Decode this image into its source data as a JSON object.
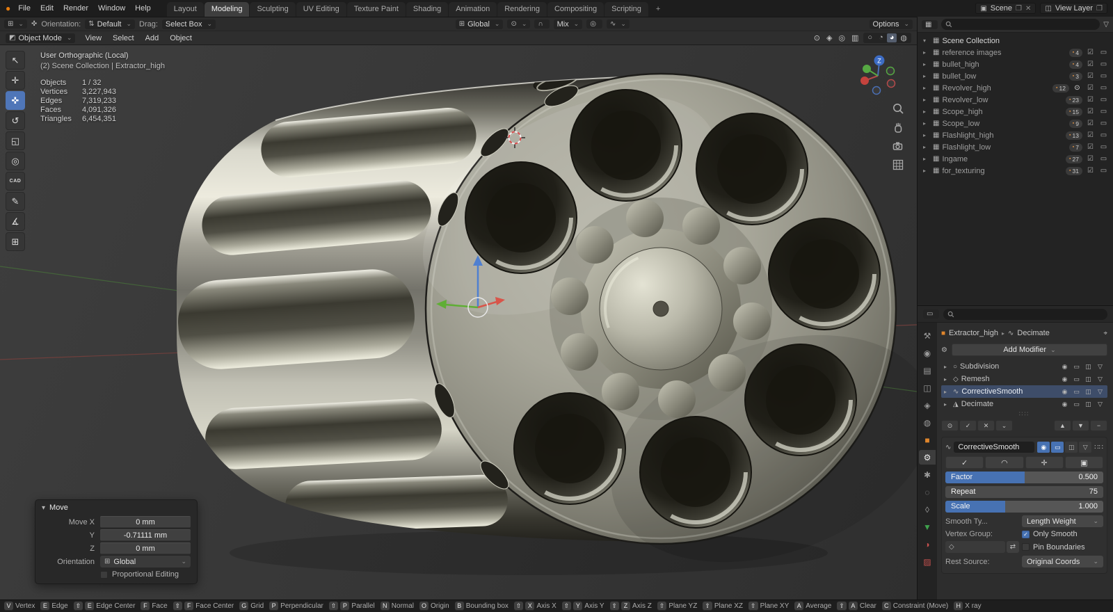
{
  "accent": "#4772b3",
  "icons": {
    "logo": "●",
    "editor_3d": "⊞",
    "move_cross": "✜",
    "orientation": "⇅",
    "scene": "▣",
    "view_layer": "◫",
    "copy": "❐",
    "close": "✕",
    "collection": "▦",
    "mesh_badge": "▪",
    "check": "☑",
    "screen": "▭",
    "eye": "⊙",
    "tri_closed": "▸",
    "tri_open": "▾",
    "filter": "▽",
    "object": "■",
    "pin": "⌖",
    "wrench": "⚙",
    "camera": "◉",
    "editmode": "◫",
    "cage": "▽",
    "dots": "∷∷",
    "spring": "∿",
    "vg": "◇",
    "swap": "⇄",
    "object_mode": "◩",
    "grid_orient": "⊞",
    "pivot": "⊙",
    "magnet": "∩",
    "prop_circle": "◎",
    "falloff": "∿",
    "xray": "▥",
    "gizmo": "◈",
    "overlays": "◎",
    "shade_wire": "○",
    "shade_solid": "◔",
    "shade_material": "◕",
    "shade_rendered": "◍"
  },
  "topbar": {
    "menus": [
      "File",
      "Edit",
      "Render",
      "Window",
      "Help"
    ],
    "workspaces": [
      "Layout",
      "Modeling",
      "Sculpting",
      "UV Editing",
      "Texture Paint",
      "Shading",
      "Animation",
      "Rendering",
      "Compositing",
      "Scripting"
    ],
    "active_workspace": "Modeling",
    "workspace_add": "+",
    "scene_label": "Scene",
    "view_layer_label": "View Layer"
  },
  "tool_settings": {
    "orientation_label": "Orientation:",
    "orientation_value": "Default",
    "drag_label": "Drag:",
    "drag_value": "Select Box",
    "transform_orientation": "Global",
    "snap_target": "Mix",
    "options_label": "Options"
  },
  "viewport_header": {
    "mode": "Object Mode",
    "menus": [
      "View",
      "Select",
      "Add",
      "Object"
    ]
  },
  "tools": [
    {
      "name": "tweak-select-tool",
      "glyph": "↖",
      "active": false
    },
    {
      "name": "cursor-tool",
      "glyph": "✛",
      "active": false
    },
    {
      "name": "move-tool",
      "glyph": "✜",
      "active": true
    },
    {
      "name": "rotate-tool",
      "glyph": "↺",
      "active": false
    },
    {
      "name": "scale-tool",
      "glyph": "◱",
      "active": false
    },
    {
      "name": "transform-tool",
      "glyph": "◎",
      "active": false
    },
    {
      "name": "cad-sketcher-tool",
      "glyph": "CAD",
      "active": false
    },
    {
      "name": "annotate-tool",
      "glyph": "✎",
      "active": false
    },
    {
      "name": "measure-tool",
      "glyph": "∡",
      "active": false
    },
    {
      "name": "add-cube-tool",
      "glyph": "⊞",
      "active": false
    }
  ],
  "viewport": {
    "view_label": "User Orthographic (Local)",
    "context_label": "(2) Scene Collection | Extractor_high",
    "stats": [
      {
        "label": "Objects",
        "value": "1 / 32"
      },
      {
        "label": "Vertices",
        "value": "3,227,943"
      },
      {
        "label": "Edges",
        "value": "7,319,233"
      },
      {
        "label": "Faces",
        "value": "4,091,326"
      },
      {
        "label": "Triangles",
        "value": "6,454,351"
      }
    ],
    "gizmo_z_label": "Z"
  },
  "move_panel": {
    "title": "Move",
    "fields": [
      {
        "label": "Move X",
        "value": "0 mm"
      },
      {
        "label": "Y",
        "value": "-0.71111 mm"
      },
      {
        "label": "Z",
        "value": "0 mm"
      }
    ],
    "orientation_label": "Orientation",
    "orientation_value": "Global",
    "proportional_label": "Proportional Editing",
    "proportional_checked": false
  },
  "outliner": {
    "root_label": "Scene Collection",
    "items": [
      {
        "name": "reference images",
        "count": "4"
      },
      {
        "name": "bullet_high",
        "count": "4"
      },
      {
        "name": "bullet_low",
        "count": "3"
      },
      {
        "name": "Revolver_high",
        "count": "12",
        "eye": true
      },
      {
        "name": "Revolver_low",
        "count": "23"
      },
      {
        "name": "Scope_high",
        "count": "15"
      },
      {
        "name": "Scope_low",
        "count": "9"
      },
      {
        "name": "Flashlight_high",
        "count": "13"
      },
      {
        "name": "Flashlight_low",
        "count": "7"
      },
      {
        "name": "Ingame",
        "count": "27"
      },
      {
        "name": "for_texturing",
        "count": "31"
      }
    ]
  },
  "properties": {
    "tabs": [
      {
        "name": "tool",
        "glyph": "⚒"
      },
      {
        "name": "render",
        "glyph": "◉"
      },
      {
        "name": "output",
        "glyph": "▤"
      },
      {
        "name": "view-layer",
        "glyph": "◫"
      },
      {
        "name": "scene",
        "glyph": "◈"
      },
      {
        "name": "world",
        "glyph": "◍"
      },
      {
        "name": "object",
        "glyph": "■",
        "color": "#e0862c"
      },
      {
        "name": "modifiers",
        "glyph": "⚙",
        "active": true
      },
      {
        "name": "particles",
        "glyph": "✱"
      },
      {
        "name": "physics",
        "glyph": "◌"
      },
      {
        "name": "constraints",
        "glyph": "◊"
      },
      {
        "name": "object-data",
        "glyph": "▼",
        "color": "#3fa34d"
      },
      {
        "name": "material",
        "glyph": "◑",
        "color": "#c4504e"
      },
      {
        "name": "texture",
        "glyph": "▨",
        "color": "#c4504e"
      }
    ],
    "breadcrumb": {
      "object": "Extractor_high",
      "modifier": "Decimate"
    },
    "add_modifier_label": "Add Modifier",
    "stack": [
      {
        "name": "Subdivision",
        "icon": "○",
        "active": false
      },
      {
        "name": "Remesh",
        "icon": "◇",
        "active": false
      },
      {
        "name": "CorrectiveSmooth",
        "icon": "∿",
        "active": true
      },
      {
        "name": "Decimate",
        "icon": "◮",
        "active": false
      }
    ],
    "stack_buttons_left": [
      {
        "name": "toggle-all-visibility",
        "glyph": "⊙"
      },
      {
        "name": "apply-all-button",
        "glyph": "✓"
      },
      {
        "name": "remove-all-button",
        "glyph": "✕"
      },
      {
        "name": "stack-extras-dropdown",
        "glyph": "⌄"
      }
    ],
    "stack_buttons_right": [
      {
        "name": "move-modifier-up",
        "glyph": "▲"
      },
      {
        "name": "move-modifier-down",
        "glyph": "▼"
      },
      {
        "name": "remove-modifier-button",
        "glyph": "−"
      }
    ],
    "detail": {
      "name": "CorrectiveSmooth",
      "toggles": [
        {
          "name": "detail-render-toggle",
          "glyph": "◉",
          "on": true
        },
        {
          "name": "detail-realtime-toggle",
          "glyph": "▭",
          "on": true
        },
        {
          "name": "detail-editmode-toggle",
          "glyph": "◫",
          "on": false
        },
        {
          "name": "detail-cage-toggle",
          "glyph": "▽",
          "on": false
        }
      ],
      "actions": [
        {
          "name": "apply-modifier-button",
          "glyph": "✓"
        },
        {
          "name": "smooth-preview-button",
          "glyph": "◠"
        },
        {
          "name": "duplicate-modifier-button",
          "glyph": "✛"
        },
        {
          "name": "copy-modifier-button",
          "glyph": "▣"
        }
      ],
      "factor_label": "Factor",
      "factor_value": "0.500",
      "factor_fill": 0.5,
      "repeat_label": "Repeat",
      "repeat_value": "75",
      "scale_label": "Scale",
      "scale_value": "1.000",
      "scale_fill": 0.38,
      "smooth_type_label": "Smooth Ty...",
      "smooth_type_value": "Length Weight",
      "vertex_group_label": "Vertex Group:",
      "only_smooth_label": "Only Smooth",
      "only_smooth_checked": true,
      "pin_boundaries_label": "Pin Boundaries",
      "pin_boundaries_checked": false,
      "rest_source_label": "Rest Source:",
      "rest_source_value": "Original Coords"
    }
  },
  "statusbar": {
    "hints": [
      {
        "keys": [
          "V"
        ],
        "label": "Vertex"
      },
      {
        "keys": [
          "E"
        ],
        "label": "Edge"
      },
      {
        "keys": [
          "⇧",
          "E"
        ],
        "label": "Edge Center"
      },
      {
        "keys": [
          "F"
        ],
        "label": "Face"
      },
      {
        "keys": [
          "⇧",
          "F"
        ],
        "label": "Face Center"
      },
      {
        "keys": [
          "G"
        ],
        "label": "Grid"
      },
      {
        "keys": [
          "P"
        ],
        "label": "Perpendicular"
      },
      {
        "keys": [
          "⇧",
          "P"
        ],
        "label": "Parallel"
      },
      {
        "keys": [
          "N"
        ],
        "label": "Normal"
      },
      {
        "keys": [
          "O"
        ],
        "label": "Origin"
      },
      {
        "keys": [
          "B"
        ],
        "label": "Bounding box"
      },
      {
        "keys": [
          "⇧",
          "X"
        ],
        "label": "Axis X"
      },
      {
        "keys": [
          "⇧",
          "Y"
        ],
        "label": "Axis Y"
      },
      {
        "keys": [
          "⇧",
          "Z"
        ],
        "label": "Axis Z"
      },
      {
        "keys": [
          "⇧"
        ],
        "label": "Plane YZ"
      },
      {
        "keys": [
          "⇧"
        ],
        "label": "Plane XZ"
      },
      {
        "keys": [
          "⇧"
        ],
        "label": "Plane XY"
      },
      {
        "keys": [
          "A"
        ],
        "label": "Average"
      },
      {
        "keys": [
          "⇧",
          "A"
        ],
        "label": "Clear"
      },
      {
        "keys": [
          "C"
        ],
        "label": "Constraint (Move)"
      },
      {
        "keys": [
          "H"
        ],
        "label": "X ray"
      }
    ]
  }
}
